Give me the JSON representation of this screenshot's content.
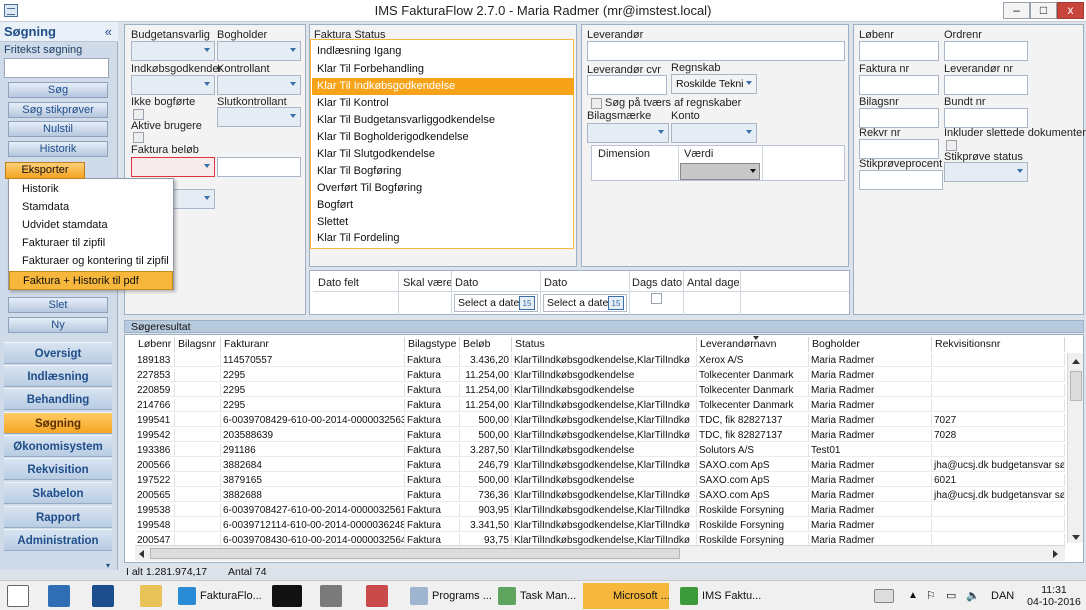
{
  "window": {
    "title": "IMS FakturaFlow 2.7.0 - Maria Radmer (mr@imstest.local)",
    "buttons": {
      "minimize": "–",
      "maximize": "□",
      "close": "x"
    }
  },
  "sidebar": {
    "title": "Søgning",
    "collapse": "«",
    "fritekst_label": "Fritekst søgning",
    "fritekst_value": "",
    "buttons": [
      "Søg",
      "Søg stikprøver",
      "Nulstil",
      "Historik"
    ],
    "eksporter": "Eksporter",
    "more_buttons": [
      "Slet",
      "Ny"
    ],
    "nav": [
      "Oversigt",
      "Indlæsning",
      "Behandling",
      "Søgning",
      "Økonomisystem",
      "Rekvisition",
      "Skabelon",
      "Rapport",
      "Administration"
    ],
    "active_nav": "Søgning"
  },
  "export_menu": {
    "items": [
      "Historik",
      "Stamdata",
      "Udvidet stamdata",
      "Fakturaer til zipfil",
      "Fakturaer og kontering til zipfil",
      "Faktura + Historik til pdf"
    ],
    "highlighted": "Faktura + Historik til pdf"
  },
  "filters": {
    "budgetansvarlig": "Budgetansvarlig",
    "bogholder": "Bogholder",
    "indkobsgodkender": "Indkøbsgodkender",
    "kontrollant": "Kontrollant",
    "ikke_bogforte": "Ikke bogførte",
    "slutkontrollant": "Slutkontrollant",
    "aktive_brugere": "Aktive brugere",
    "faktura_belob": "Faktura beløb"
  },
  "faktura_status": {
    "label": "Faktura Status",
    "items": [
      "Indlæsning Igang",
      "Klar Til Forbehandling",
      "Klar Til Indkøbsgodkendelse",
      "Klar Til Kontrol",
      "Klar Til Budgetansvarliggodkendelse",
      "Klar Til Bogholderigodkendelse",
      "Klar Til Slutgodkendelse",
      "Klar Til Bogføring",
      "Overført Til Bogføring",
      "Bogført",
      "Slettet",
      "Klar Til Fordeling"
    ],
    "selected": "Klar Til Indkøbsgodkendelse"
  },
  "leverandor": {
    "leverandor": "Leverandør",
    "leverandor_cvr": "Leverandør cvr",
    "regnskab": "Regnskab",
    "regnskab_value": "Roskilde Tekni",
    "sog_tvaers": "Søg på tværs af regnskaber",
    "bilagsmaerke": "Bilagsmærke",
    "konto": "Konto",
    "dimension": "Dimension",
    "vaerdi": "Værdi"
  },
  "right_fields": {
    "lobenr": "Løbenr",
    "ordrenr": "Ordrenr",
    "faktura_nr": "Faktura nr",
    "leverandor_nr": "Leverandør nr",
    "bilagsnr": "Bilagsnr",
    "bundt_nr": "Bundt nr",
    "rekvr_nr": "Rekvr nr",
    "inkluder_slettede": "Inkluder slettede dokumenter",
    "stikprove_status": "Stikprøve status",
    "stikproveprocent": "Stikprøveprocent"
  },
  "dates": {
    "dato_felt": "Dato felt",
    "skal_vaere": "Skal være",
    "dato1": "Dato",
    "dato2": "Dato",
    "dags_dato": "Dags dato",
    "antal_dage": "Antal dage",
    "select_a_date_1": "Select a date",
    "select_a_date_2": "Select a date",
    "cal_day": "15"
  },
  "results": {
    "title": "Søgeresultat",
    "columns": [
      "Løbenr",
      "Bilagsnr",
      "Fakturanr",
      "Bilagstype",
      "Beløb",
      "Status",
      "Leverandørnavn",
      "Bogholder",
      "Rekvisitionsnr"
    ],
    "rows": [
      [
        "189183",
        "",
        "114570557",
        "Faktura",
        "3.436,20",
        "KlarTilIndkøbsgodkendelse,KlarTilIndkø",
        "Xerox A/S",
        "Maria Radmer",
        ""
      ],
      [
        "227853",
        "",
        "2295",
        "Faktura",
        "11.254,00",
        "KlarTilIndkøbsgodkendelse",
        "Tolkecenter Danmark",
        "Maria Radmer",
        ""
      ],
      [
        "220859",
        "",
        "2295",
        "Faktura",
        "11.254,00",
        "KlarTilIndkøbsgodkendelse",
        "Tolkecenter Danmark",
        "Maria Radmer",
        ""
      ],
      [
        "214766",
        "",
        "2295",
        "Faktura",
        "11.254,00",
        "KlarTilIndkøbsgodkendelse,KlarTilIndkø",
        "Tolkecenter Danmark",
        "Maria Radmer",
        ""
      ],
      [
        "199541",
        "",
        "6-0039708429-610-00-2014-0000032563",
        "Faktura",
        "500,00",
        "KlarTilIndkøbsgodkendelse,KlarTilIndkø",
        "TDC,  fik  82827137",
        "Maria Radmer",
        "7027"
      ],
      [
        "199542",
        "",
        "203588639",
        "Faktura",
        "500,00",
        "KlarTilIndkøbsgodkendelse,KlarTilIndkø",
        "TDC,  fik  82827137",
        "Maria Radmer",
        "7028"
      ],
      [
        "193386",
        "",
        "291186",
        "Faktura",
        "3.287,50",
        "KlarTilIndkøbsgodkendelse",
        "Solutors A/S",
        "Test01",
        ""
      ],
      [
        "200566",
        "",
        "3882684",
        "Faktura",
        "246,79",
        "KlarTilIndkøbsgodkendelse,KlarTilIndkø",
        "SAXO.com ApS",
        "Maria Radmer",
        "jha@ucsj.dk budgetansvar sø"
      ],
      [
        "197522",
        "",
        "3879165",
        "Faktura",
        "500,00",
        "KlarTilIndkøbsgodkendelse",
        "SAXO.com ApS",
        "Maria Radmer",
        "6021"
      ],
      [
        "200565",
        "",
        "3882688",
        "Faktura",
        "736,36",
        "KlarTilIndkøbsgodkendelse,KlarTilIndkø",
        "SAXO.com ApS",
        "Maria Radmer",
        "jha@ucsj.dk budgetansvar sø"
      ],
      [
        "199538",
        "",
        "6-0039708427-610-00-2014-0000032561",
        "Faktura",
        "903,95",
        "KlarTilIndkøbsgodkendelse,KlarTilIndkø",
        "Roskilde Forsyning",
        "Maria Radmer",
        ""
      ],
      [
        "199548",
        "",
        "6-0039712114-610-00-2014-0000036248",
        "Faktura",
        "3.341,50",
        "KlarTilIndkøbsgodkendelse,KlarTilIndkø",
        "Roskilde Forsyning",
        "Maria Radmer",
        ""
      ],
      [
        "200547",
        "",
        "6-0039708430-610-00-2014-0000032564",
        "Faktura",
        "93,75",
        "KlarTilIndkøbsgodkendelse,KlarTilIndkø",
        "Roskilde Forsyning",
        "Maria Radmer",
        ""
      ]
    ],
    "footer_total": "I alt  1.281.974,17",
    "footer_count": "Antal  74"
  },
  "taskbar": {
    "items": [
      "FakturaFlo...",
      "Programs ...",
      "Task Man...",
      "Microsoft ...",
      "IMS Faktu..."
    ],
    "lang": "DAN",
    "time": "11:31",
    "date": "04-10-2016"
  }
}
